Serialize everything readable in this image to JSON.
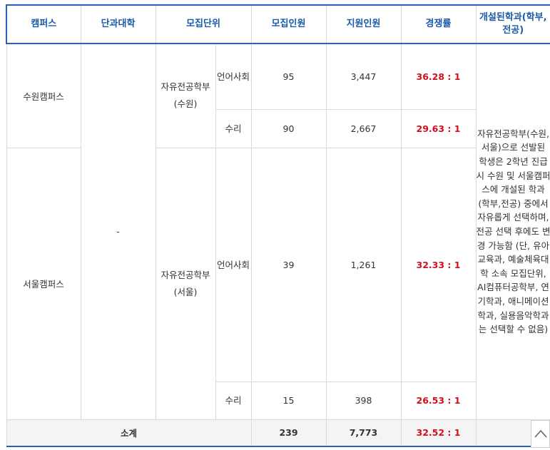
{
  "headers": {
    "campus": "캠퍼스",
    "college": "단과대학",
    "unit": "모집단위",
    "quota": "모집인원",
    "applicants": "지원인원",
    "ratio": "경쟁률",
    "majors": "개설된학과(학부,전공)"
  },
  "college_value": "-",
  "campuses": {
    "suwon": "수원캠퍼스",
    "seoul": "서울캠퍼스"
  },
  "units": {
    "suwon": "자유전공학부(수원)",
    "seoul": "자유전공학부(서울)"
  },
  "rows": [
    {
      "sub": "언어사회",
      "quota": "95",
      "applicants": "3,447",
      "ratio": "36.28 : 1"
    },
    {
      "sub": "수리",
      "quota": "90",
      "applicants": "2,667",
      "ratio": "29.63 : 1"
    },
    {
      "sub": "언어사회",
      "quota": "39",
      "applicants": "1,261",
      "ratio": "32.33 : 1"
    },
    {
      "sub": "수리",
      "quota": "15",
      "applicants": "398",
      "ratio": "26.53 : 1"
    }
  ],
  "description": "자유전공학부(수원,서울)으로 선발된 학생은 2학년 진급시 수원 및 서울캠퍼스에 개설된 학과(학부,전공) 중에서 자유롭게 선택하며, 전공 선택 후에도 변경 가능함 (단, 유아교육과, 예술체육대학 소속 모집단위, AI컴퓨터공학부, 연기학과, 애니메이션학과, 실용음악학과는 선택할 수 없음)",
  "total": {
    "label": "소계",
    "quota": "239",
    "applicants": "7,773",
    "ratio": "32.52 : 1"
  },
  "icons": {
    "scroll_top": "chevron-up-icon"
  },
  "colors": {
    "header_text": "#1a5aa8",
    "border_accent": "#2a62b0",
    "ratio_text": "#d0111b"
  }
}
